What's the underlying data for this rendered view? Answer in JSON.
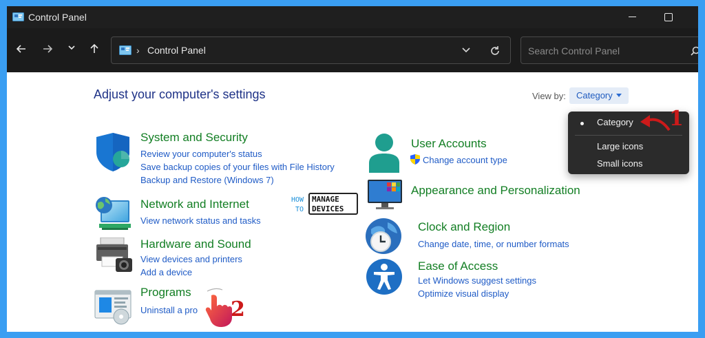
{
  "window": {
    "title": "Control Panel"
  },
  "nav": {
    "breadcrumb": "Control Panel",
    "breadcrumb_sep": "›"
  },
  "search": {
    "placeholder": "Search Control Panel"
  },
  "main": {
    "heading": "Adjust your computer's settings",
    "view_by_label": "View by:",
    "view_by_value": "Category"
  },
  "view_menu": {
    "options": [
      "Category",
      "Large icons",
      "Small icons"
    ],
    "selected": "Category"
  },
  "categories": {
    "system_security": {
      "title": "System and Security",
      "links": [
        "Review your computer's status",
        "Save backup copies of your files with File History",
        "Backup and Restore (Windows 7)"
      ]
    },
    "network": {
      "title": "Network and Internet",
      "links": [
        "View network status and tasks"
      ]
    },
    "hardware": {
      "title": "Hardware and Sound",
      "links": [
        "View devices and printers",
        "Add a device"
      ]
    },
    "programs": {
      "title": "Programs",
      "links": [
        "Uninstall a pro"
      ]
    },
    "user_accounts": {
      "title": "User Accounts",
      "links": [
        "Change account type"
      ]
    },
    "appearance": {
      "title": "Appearance and Personalization",
      "links": []
    },
    "clock": {
      "title": "Clock and Region",
      "links": [
        "Change date, time, or number formats"
      ]
    },
    "ease": {
      "title": "Ease of Access",
      "links": [
        "Let Windows suggest settings",
        "Optimize visual display"
      ]
    }
  },
  "watermark": {
    "line1_a": "HOW",
    "line1_b": "MANAGE",
    "line2_a": "TO",
    "line2_b": "DEVICES"
  },
  "annotations": {
    "step1": "1",
    "step2": "2"
  },
  "colors": {
    "frame": "#3a9ef2",
    "title_green": "#127e23",
    "link_blue": "#1f5bc6",
    "heading_blue": "#1e3287",
    "annotation_red": "#cc1a1a"
  }
}
